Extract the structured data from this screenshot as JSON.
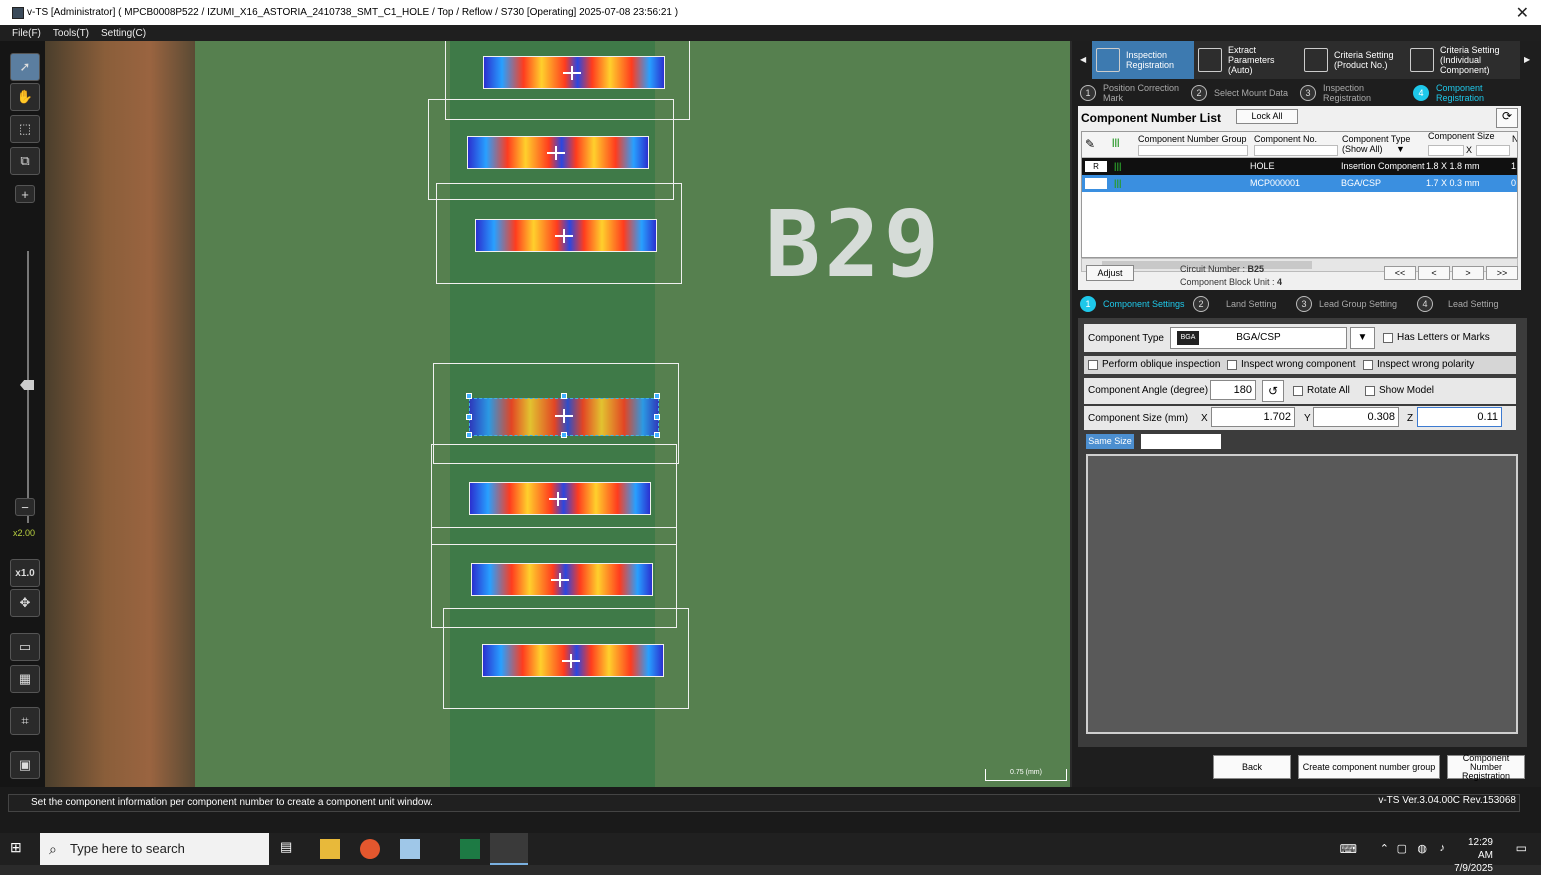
{
  "window": {
    "title": "v-TS [Administrator] ( MPCB0008P522  /  IZUMI_X16_ASTORIA_2410738_SMT_C1_HOLE  /  Top  /  Reflow  /  S730  [Operating]  2025-07-08 23:56:21 )",
    "close_glyph": "✕"
  },
  "menu": {
    "file": "File(F)",
    "tools": "Tools(T)",
    "setting": "Setting(C)"
  },
  "toolbar": {
    "zoom_value": "x2.00",
    "zoom_reset": "x1.0",
    "plus": "+",
    "minus": "−"
  },
  "viewer": {
    "silk_text": "B29",
    "scale_label": "0.75 (mm)"
  },
  "ribbon": {
    "items": [
      {
        "label": "Inspection Registration"
      },
      {
        "label": "Extract Parameters (Auto)"
      },
      {
        "label": "Criteria Setting (Product No.)"
      },
      {
        "label": "Criteria Setting (Individual Component)"
      }
    ]
  },
  "steps": [
    {
      "num": "1",
      "label": "Position Correction Mark"
    },
    {
      "num": "2",
      "label": "Select Mount Data"
    },
    {
      "num": "3",
      "label": "Inspection Registration"
    },
    {
      "num": "4",
      "label": "Component Registration"
    }
  ],
  "list": {
    "title": "Component Number List",
    "lock_all": "Lock All",
    "headers": {
      "group": "Component Number Group",
      "number": "Component No.",
      "type": "Component Type",
      "type_filter": "(Show All)",
      "size": "Component Size",
      "size_x": "X",
      "n": "N"
    },
    "rows": [
      {
        "mark": "R",
        "group": "",
        "number": "HOLE",
        "type": "Insertion Component",
        "size": "1.8 X 1.8 mm",
        "n": "1"
      },
      {
        "mark": "",
        "group": "",
        "number": "MCP000001",
        "type": "BGA/CSP",
        "size": "1.7 X 0.3 mm",
        "n": "0"
      }
    ],
    "adjust": "Adjust",
    "circuit_label": "Circuit Number : ",
    "circuit_value": "B25",
    "block_label": "Component Block Unit : ",
    "block_value": "4",
    "pager": [
      "<<",
      "<",
      ">",
      ">>"
    ]
  },
  "settings_steps": [
    {
      "num": "1",
      "label": "Component Settings"
    },
    {
      "num": "2",
      "label": "Land Setting"
    },
    {
      "num": "3",
      "label": "Lead Group Setting"
    },
    {
      "num": "4",
      "label": "Lead Setting"
    }
  ],
  "settings": {
    "component_type_label": "Component Type",
    "component_type_value": "BGA/CSP",
    "has_letters": "Has Letters or Marks",
    "oblique": "Perform oblique inspection",
    "wrong_component": "Inspect wrong component",
    "wrong_polarity": "Inspect wrong polarity",
    "angle_label": "Component Angle (degree)",
    "angle_value": "180",
    "rotate_all": "Rotate All",
    "show_model": "Show Model",
    "size_label": "Component Size (mm)",
    "x_label": "X",
    "x_value": "1.702",
    "y_label": "Y",
    "y_value": "0.308",
    "z_label": "Z",
    "z_value": "0.11",
    "same_size": "Same Size"
  },
  "buttons": {
    "back": "Back",
    "create_group": "Create component number group",
    "register": "Component Number Registration"
  },
  "status": {
    "message": "Set the component information per component number to create a component unit window.",
    "version": "v-TS Ver.3.04.00C Rev.153068"
  },
  "taskbar": {
    "search_placeholder": "Type here to search",
    "time": "12:29 AM",
    "date": "7/9/2025"
  },
  "colors": {
    "accent": "#1ec8ea",
    "ribbon_active": "#3d7ab0",
    "row_selected": "#3a8fe0"
  }
}
